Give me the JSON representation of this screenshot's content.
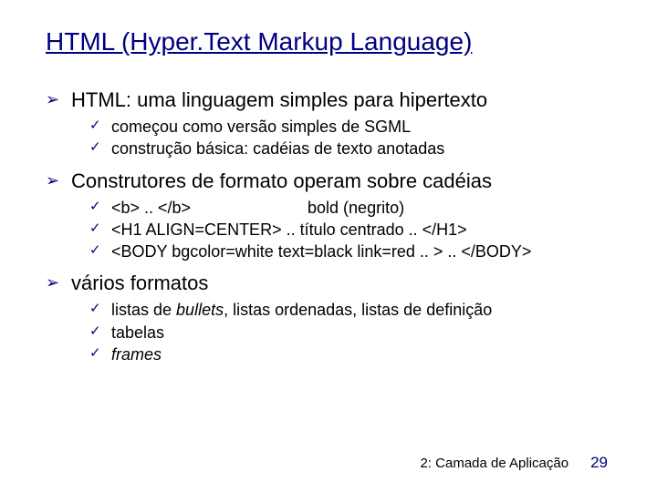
{
  "title": "HTML (Hyper.Text Markup Language)",
  "bullets": {
    "b1": {
      "text": "HTML: uma linguagem simples para hipertexto",
      "sub": {
        "s1": "começou como versão simples de SGML",
        "s2": "construção básica: cadéias de texto anotadas"
      }
    },
    "b2": {
      "text": "Construtores de formato operam sobre cadéias",
      "sub": {
        "s1a": "<b> .. </b>",
        "s1b": "bold (negrito)",
        "s2": "<H1 ALIGN=CENTER> .. título centrado .. </H1>",
        "s3": "<BODY bgcolor=white text=black link=red .. > .. </BODY>"
      }
    },
    "b3": {
      "text": "vários formatos",
      "sub": {
        "s1a": "listas de ",
        "s1b": "bullets",
        "s1c": ", listas ordenadas, listas de definição",
        "s2": "tabelas",
        "s3a": "frames"
      }
    }
  },
  "footer": {
    "label": "2: Camada de Aplicação",
    "page": "29"
  }
}
